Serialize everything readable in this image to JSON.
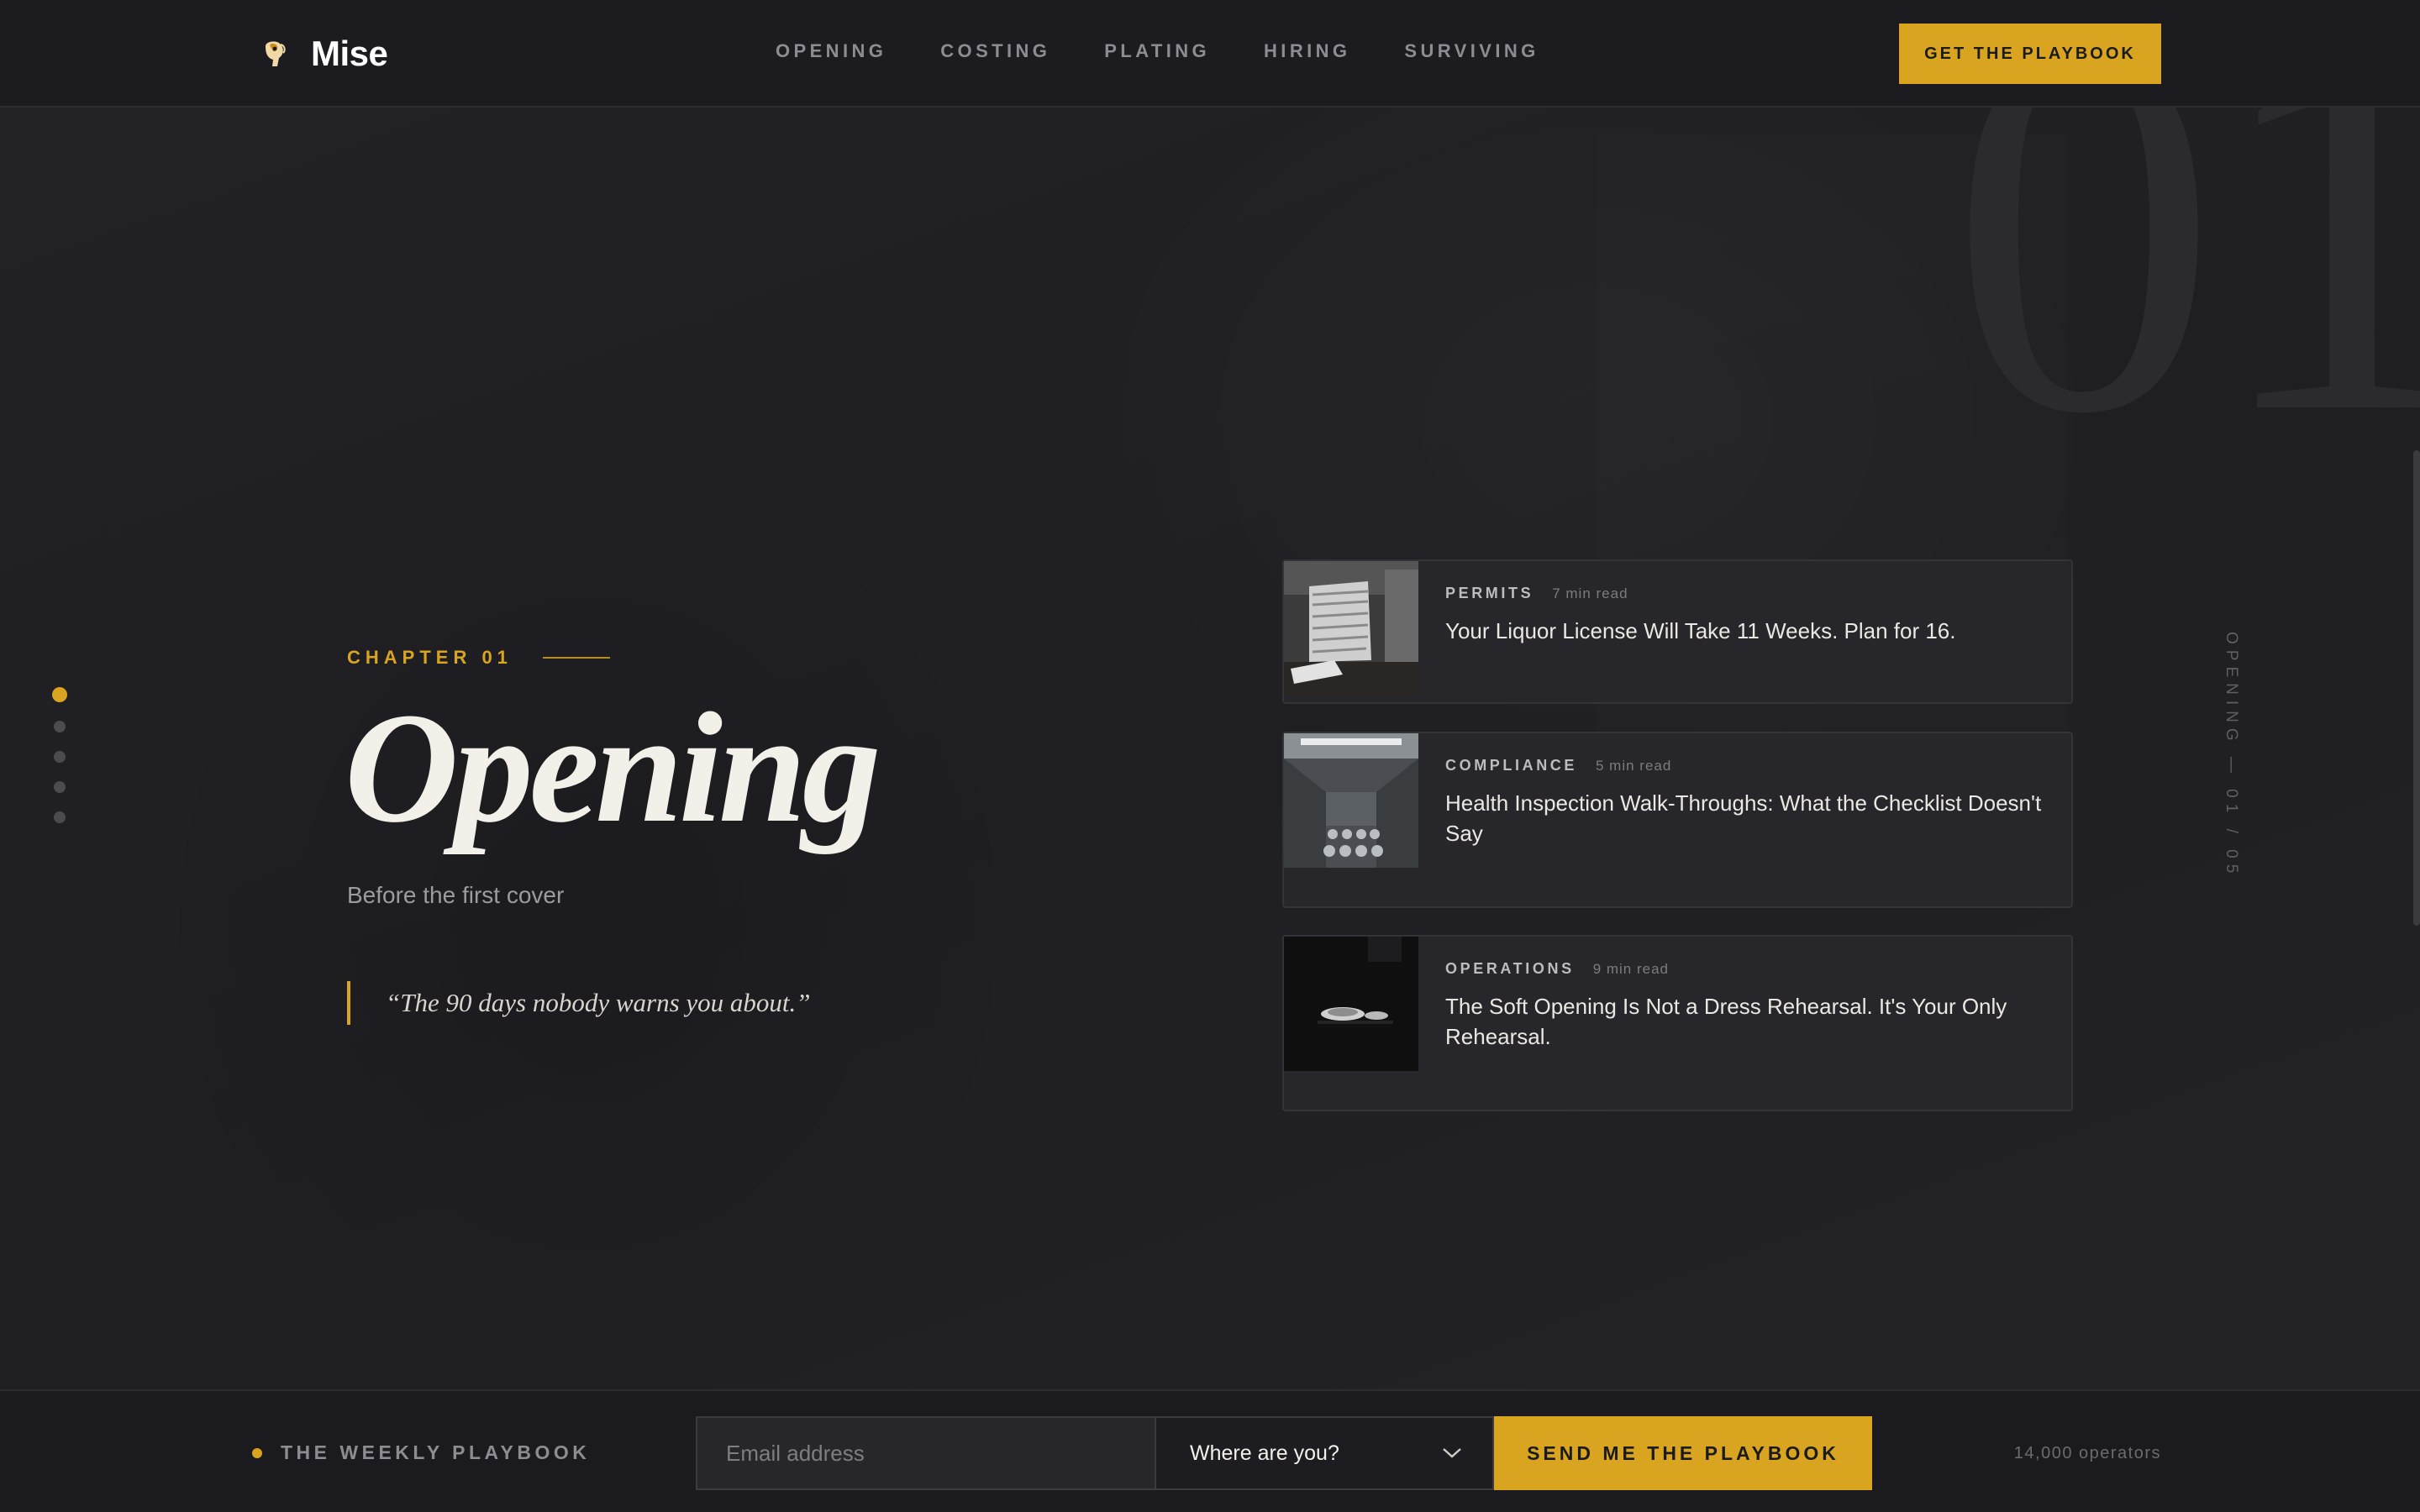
{
  "brand": {
    "name": "Mise"
  },
  "nav": {
    "items": [
      "OPENING",
      "COSTING",
      "PLATING",
      "HIRING",
      "SURVIVING"
    ]
  },
  "header": {
    "cta_label": "GET THE PLAYBOOK"
  },
  "chapter": {
    "number_display": "01",
    "label": "CHAPTER 01",
    "title": "Opening",
    "subtitle": "Before the first cover",
    "quote": "“The 90 days nobody warns you about.”",
    "side_label": "OPENING — 01 / 05"
  },
  "chapter_nav": {
    "total": 5,
    "active_index": 0
  },
  "articles": [
    {
      "tag": "PERMITS",
      "read_time": "7 min read",
      "title": "Your Liquor License Will Take 11 Weeks. Plan for 16."
    },
    {
      "tag": "COMPLIANCE",
      "read_time": "5 min read",
      "title": "Health Inspection Walk-Throughs: What the Checklist Doesn't Say"
    },
    {
      "tag": "OPERATIONS",
      "read_time": "9 min read",
      "title": "The Soft Opening Is Not a Dress Rehearsal. It's Your Only Rehearsal."
    }
  ],
  "newsletter": {
    "label": "THE WEEKLY PLAYBOOK",
    "email_placeholder": "Email address",
    "location_value": "Where are you?",
    "submit_label": "SEND ME THE PLAYBOOK",
    "subscriber_count": "14,000 operators"
  },
  "colors": {
    "accent": "#d9a521",
    "background": "#202024",
    "surface": "#27272b"
  }
}
